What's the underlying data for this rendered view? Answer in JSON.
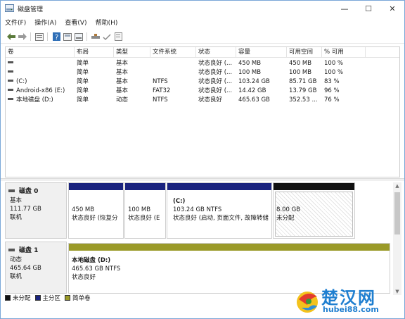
{
  "window": {
    "title": "磁盘管理",
    "min_glyph": "—",
    "max_glyph": "☐",
    "close_glyph": "✕"
  },
  "menu": [
    "文件(F)",
    "操作(A)",
    "查看(V)",
    "帮助(H)"
  ],
  "toolbar_icons": [
    "back-arrow-icon",
    "forward-arrow-icon",
    "properties-icon",
    "help-icon",
    "refresh-icon",
    "settings-icon",
    "disk-icon",
    "checkmark-icon",
    "document-icon"
  ],
  "volume_list": {
    "columns": [
      "卷",
      "布局",
      "类型",
      "文件系统",
      "状态",
      "容量",
      "可用空间",
      "% 可用"
    ],
    "rows": [
      {
        "vol": "",
        "layout": "简单",
        "type": "基本",
        "fs": "",
        "status": "状态良好 (...",
        "capacity": "450 MB",
        "free": "450 MB",
        "pct": "100 %"
      },
      {
        "vol": "",
        "layout": "简单",
        "type": "基本",
        "fs": "",
        "status": "状态良好 (...",
        "capacity": "100 MB",
        "free": "100 MB",
        "pct": "100 %"
      },
      {
        "vol": "(C:)",
        "layout": "简单",
        "type": "基本",
        "fs": "NTFS",
        "status": "状态良好 (...",
        "capacity": "103.24 GB",
        "free": "85.71 GB",
        "pct": "83 %"
      },
      {
        "vol": "Android-x86 (E:)",
        "layout": "简单",
        "type": "基本",
        "fs": "FAT32",
        "status": "状态良好 (...",
        "capacity": "14.42 GB",
        "free": "13.79 GB",
        "pct": "96 %"
      },
      {
        "vol": "本地磁盘 (D:)",
        "layout": "简单",
        "type": "动态",
        "fs": "NTFS",
        "status": "状态良好",
        "capacity": "465.63 GB",
        "free": "352.53 ...",
        "pct": "76 %"
      }
    ]
  },
  "disks": [
    {
      "name": "磁盘 0",
      "type": "基本",
      "size": "111.77 GB",
      "status": "联机",
      "partitions": [
        {
          "name": "",
          "size": "450 MB",
          "status": "状态良好 (恢复分",
          "bar_color": "#1a237e"
        },
        {
          "name": "",
          "size": "100 MB",
          "status": "状态良好 (E",
          "bar_color": "#1a237e"
        },
        {
          "name": "(C:)",
          "size": "103.24 GB NTFS",
          "status": "状态良好 (启动, 页面文件, 故障转储",
          "bar_color": "#1a237e"
        },
        {
          "name": "",
          "size": "8.00 GB",
          "status": "未分配",
          "bar_color": "#111111"
        }
      ]
    },
    {
      "name": "磁盘 1",
      "type": "动态",
      "size": "465.64 GB",
      "status": "联机",
      "partitions": [
        {
          "name": "本地磁盘  (D:)",
          "size": "465.63 GB NTFS",
          "status": "状态良好",
          "bar_color": "#9a9a28"
        }
      ]
    }
  ],
  "legend": [
    {
      "label": "未分配",
      "color": "#111111"
    },
    {
      "label": "主分区",
      "color": "#1a237e"
    },
    {
      "label": "简单卷",
      "color": "#9a9a28"
    }
  ],
  "watermark": {
    "text": "楚汉网",
    "url": "hubei88.com"
  },
  "colors": {
    "primary_partition": "#1a237e",
    "unallocated": "#111111",
    "simple_volume": "#9a9a28",
    "watermark_blue": "#1f7fd0"
  }
}
